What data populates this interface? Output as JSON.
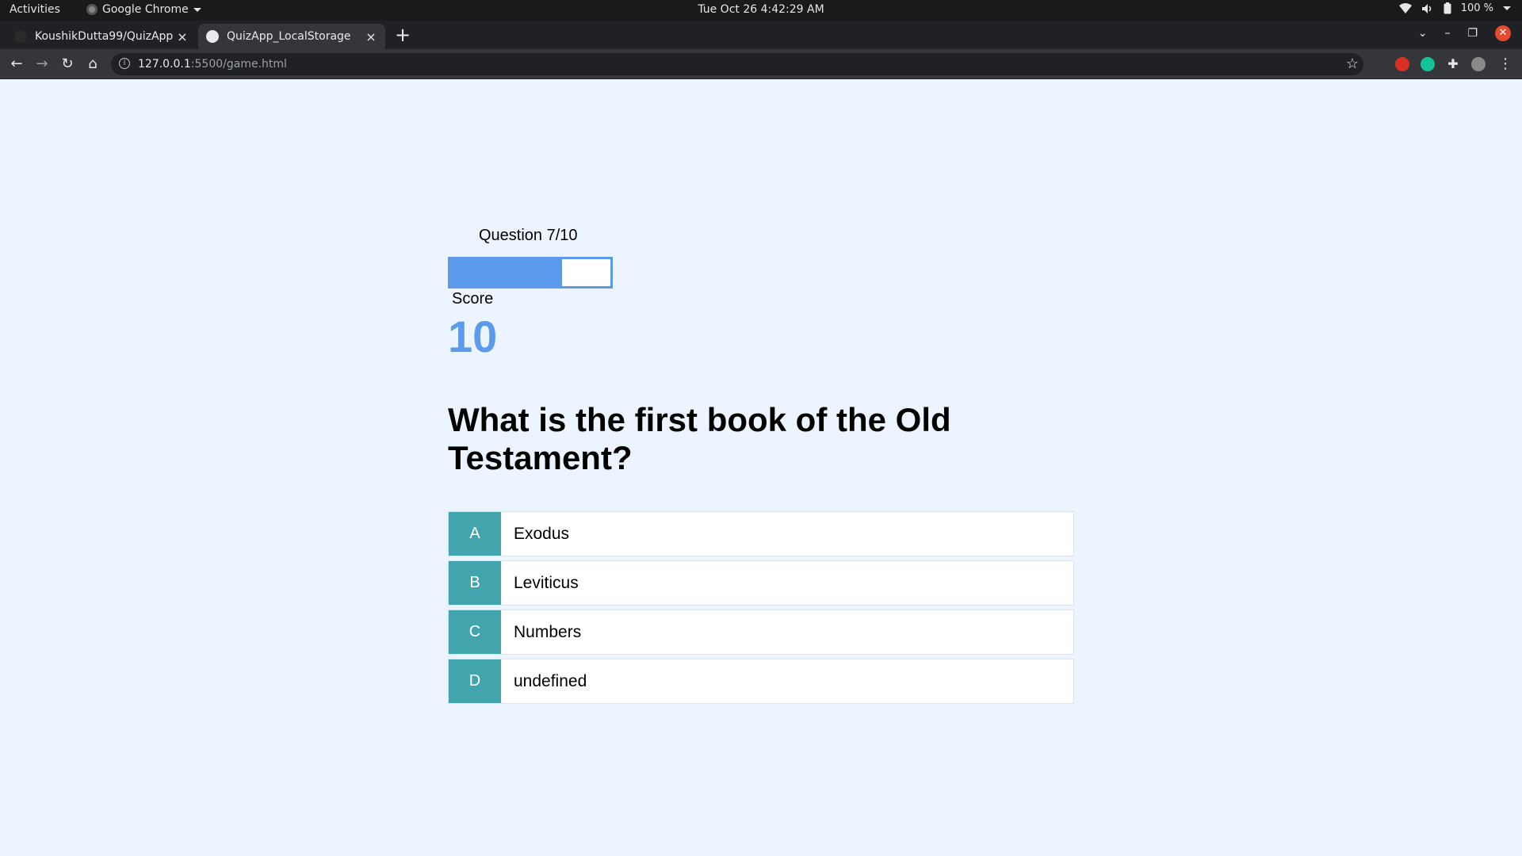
{
  "system_bar": {
    "activities": "Activities",
    "app_name": "Google Chrome",
    "clock": "Tue Oct 26  4:42:29 AM",
    "battery": "100 %"
  },
  "browser": {
    "tabs": [
      {
        "label": "KoushikDutta99/QuizApp"
      },
      {
        "label": "QuizApp_LocalStorage"
      }
    ],
    "url_host": "127.0.0.1",
    "url_path": ":5500/game.html"
  },
  "hud": {
    "progress_text": "Question 7/10",
    "progress": 0.7,
    "score_label": "Score",
    "score": "10"
  },
  "question": "What is the first book of the Old Testament?",
  "choices": [
    {
      "prefix": "A",
      "text": "Exodus"
    },
    {
      "prefix": "B",
      "text": "Leviticus"
    },
    {
      "prefix": "C",
      "text": "Numbers"
    },
    {
      "prefix": "D",
      "text": "undefined"
    }
  ],
  "colors": {
    "accent": "#5c9aeb",
    "choice_prefix": "#42a5ad",
    "background": "#ecf5ff"
  }
}
